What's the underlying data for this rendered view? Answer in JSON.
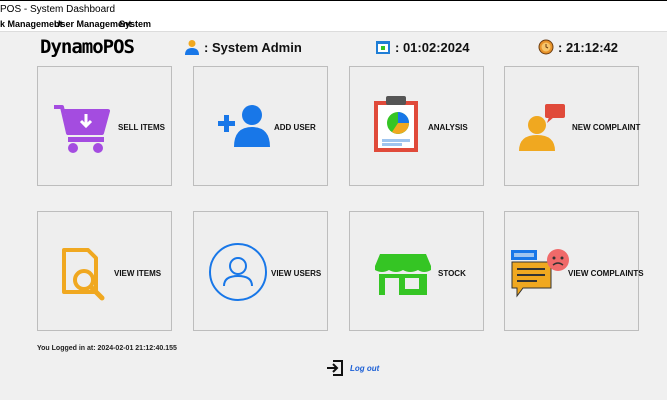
{
  "window": {
    "title": "POS - System Dashboard"
  },
  "menu": {
    "items": [
      "k Management",
      "User Management",
      "System"
    ]
  },
  "header": {
    "logo": "DynamoPOS",
    "user": ": System Admin",
    "date": ": 01:02:2024",
    "time": ": 21:12:42"
  },
  "tiles": {
    "sell_items": "SELL ITEMS",
    "add_user": "ADD USER",
    "analysis": "ANALYSIS",
    "new_complaint": "NEW COMPLAINT",
    "view_items": "VIEW ITEMS",
    "view_users": "VIEW USERS",
    "stock": "STOCK",
    "view_complaints": "VIEW COMPLAINTS"
  },
  "status": {
    "login_text": "You Logged in at: 2024-02-01 21:12:40.155"
  },
  "logout": {
    "label": "Log out"
  },
  "colors": {
    "purple": "#a44ce0",
    "blue": "#1877e8",
    "orange": "#f0a820",
    "green": "#35c524",
    "red": "#e04a3a",
    "link": "#1b5fd6"
  }
}
